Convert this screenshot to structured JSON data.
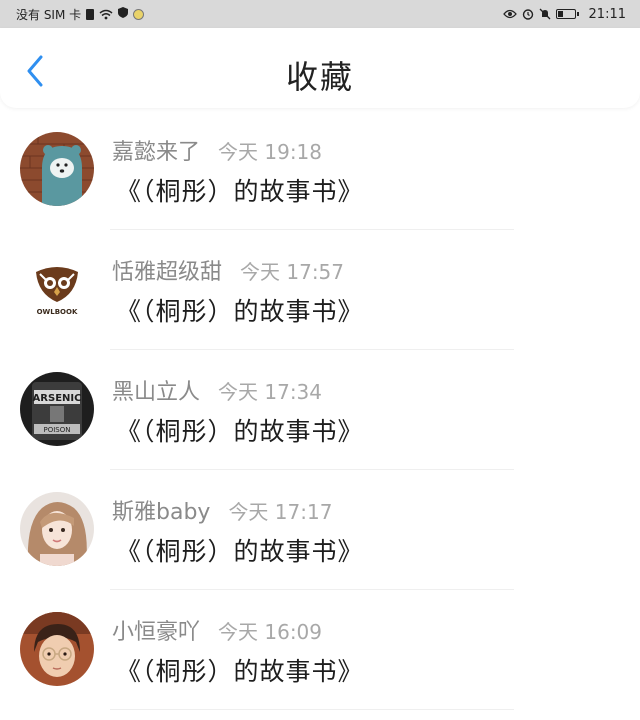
{
  "status_bar": {
    "carrier": "没有 SIM 卡",
    "time": "21:11",
    "battery_level": 0.35,
    "icons": [
      "sim-icon",
      "wifi-icon",
      "eye-icon",
      "alarm-icon",
      "mute-icon",
      "battery-icon"
    ]
  },
  "header": {
    "back_icon": "chevron-left-icon",
    "title": "收藏"
  },
  "colors": {
    "accent": "#2f8ff0",
    "status_bar_bg": "#d9d9d9",
    "username": "#8a8a8a",
    "timestamp": "#a8a8a8",
    "title_text": "#1e1e1e"
  },
  "favorites": [
    {
      "username": "嘉懿来了",
      "time": "今天 19:18",
      "title": "《（桐彤）的故事书》",
      "avatar": "bear-hoodie-avatar"
    },
    {
      "username": "恬雅超级甜",
      "time": "今天 17:57",
      "title": "《（桐彤）的故事书》",
      "avatar": "owlbook-logo-avatar",
      "avatar_text": "OWLBOOK"
    },
    {
      "username": "黑山立人",
      "time": "今天 17:34",
      "title": "《（桐彤）的故事书》",
      "avatar": "arsenic-bottle-avatar",
      "avatar_text": [
        "ARSENIC",
        "POISON"
      ]
    },
    {
      "username": "斯雅baby",
      "time": "今天 17:17",
      "title": "《（桐彤）的故事书》",
      "avatar": "girl-photo-avatar"
    },
    {
      "username": "小恒豪吖",
      "time": "今天 16:09",
      "title": "《（桐彤）的故事书》",
      "avatar": "boy-photo-avatar"
    }
  ]
}
